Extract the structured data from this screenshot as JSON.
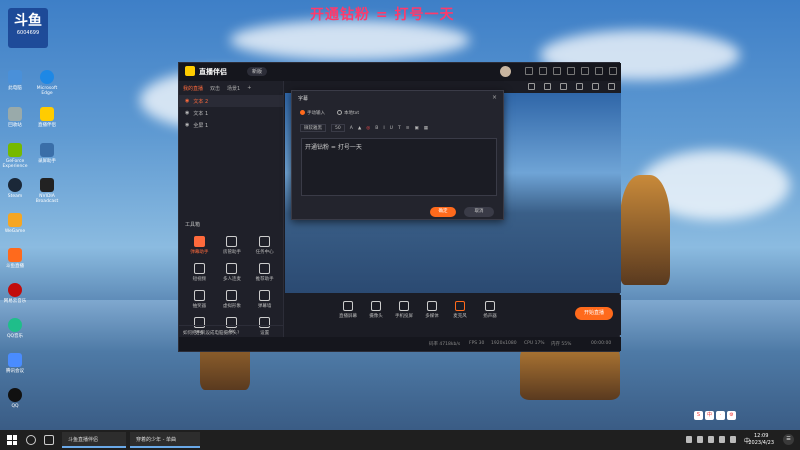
{
  "overlay": {
    "title": "开通钻粉 = 打号一天"
  },
  "desktop": {
    "badge": {
      "line1": "斗鱼",
      "line2": "6004699"
    },
    "icons": [
      {
        "label": "此电脑",
        "color": "#4a90d9"
      },
      {
        "label": "Microsoft Edge",
        "color": "#1e88e5"
      },
      {
        "label": "回收站",
        "color": "#9aa"
      },
      {
        "label": "直播伴侣",
        "color": "#ffcc00"
      },
      {
        "label": "GeForce Experience",
        "color": "#76b900"
      },
      {
        "label": "录屏助手",
        "color": "#3a6ea8"
      },
      {
        "label": "Steam",
        "color": "#1b2838"
      },
      {
        "label": "NVIDIA Broadcast",
        "color": "#222"
      },
      {
        "label": "WeGame",
        "color": "#f5a623"
      },
      {
        "label": "斗鱼直播",
        "color": "#ff6a1c"
      },
      {
        "label": "网易云音乐",
        "color": "#c20c0c"
      },
      {
        "label": "QQ音乐",
        "color": "#1fbe8a"
      },
      {
        "label": "腾讯会议",
        "color": "#4a8cff"
      },
      {
        "label": "QQ",
        "color": "#111"
      }
    ]
  },
  "app": {
    "name": "直播伴侣",
    "version_btn": "新版",
    "scene_tabs": [
      "我的直播",
      "双击",
      "场景1",
      "+"
    ],
    "sources": [
      {
        "label": "文本 2",
        "selected": true
      },
      {
        "label": "文本 1",
        "selected": false
      },
      {
        "label": "全屏 1",
        "selected": false
      }
    ],
    "tools_title": "工具箱",
    "tools": [
      {
        "label": "弹幕助手",
        "active": true
      },
      {
        "label": "房管助手",
        "active": false
      },
      {
        "label": "任务中心",
        "active": false
      },
      {
        "label": "短视频",
        "active": false
      },
      {
        "label": "多人连麦",
        "active": false
      },
      {
        "label": "推荐助手",
        "active": false
      },
      {
        "label": "抽奖器",
        "active": false
      },
      {
        "label": "虚拟形象",
        "active": false
      },
      {
        "label": "弹幕墙",
        "active": false
      },
      {
        "label": "更多",
        "active": false
      },
      {
        "label": "PK",
        "active": false
      },
      {
        "label": "设置",
        "active": false
      }
    ],
    "left_footer": "如何把手机设成电脑摄像头?",
    "bottom_tools": [
      "直播屏幕",
      "摄像头",
      "手机投屏",
      "多媒体",
      "麦克风",
      "扬声器"
    ],
    "live_button": "开始直播",
    "status": {
      "bitrate": "码率 4718kb/s",
      "fps": "FPS 30",
      "resolution": "1920x1080",
      "cpu": "CPU 17%",
      "memory": "内存 55%",
      "time": "00:00:00"
    }
  },
  "dialog": {
    "title": "字幕",
    "radio_manual": "手动输入",
    "radio_file": "本地txt",
    "font_name": "微软雅黑",
    "font_size": "50",
    "text_value": "开通钻粉 = 打号一天",
    "confirm": "确定",
    "cancel": "取消"
  },
  "taskbar": {
    "apps": [
      {
        "label": "斗鱼直播伴侣"
      },
      {
        "label": "穿着的少年 - 单曲"
      }
    ],
    "time": "12:09",
    "date": "2023/4/23",
    "ime": "中"
  }
}
